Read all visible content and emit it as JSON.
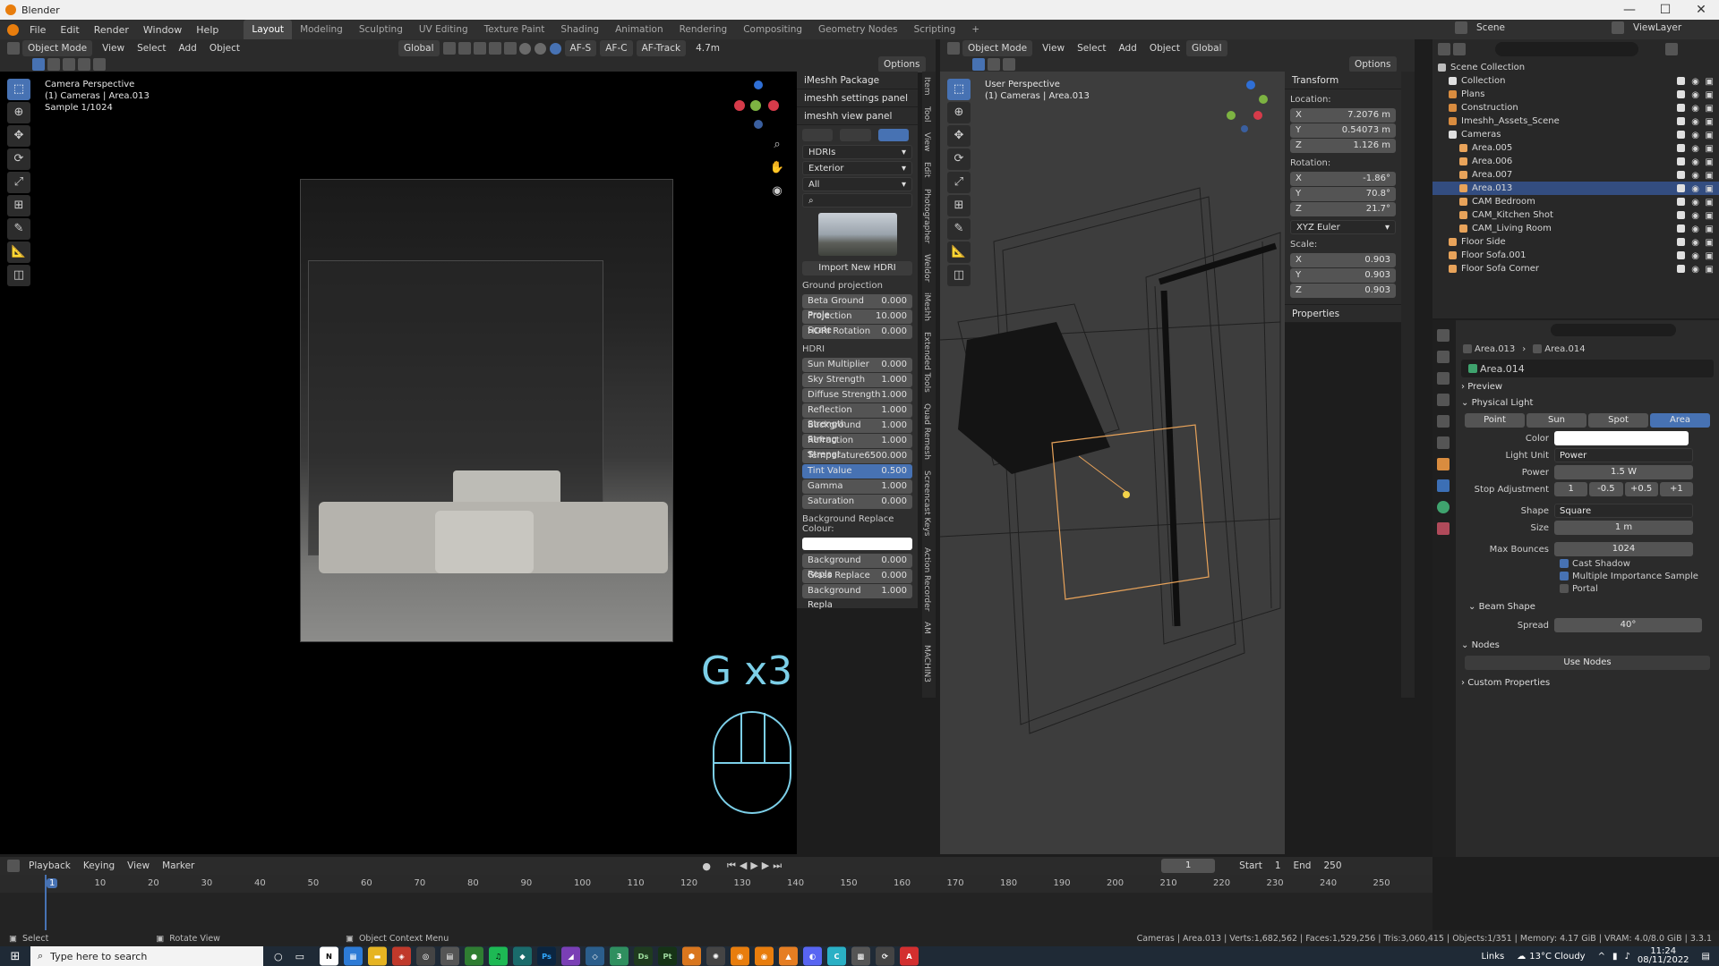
{
  "app": {
    "title": "Blender"
  },
  "window_controls": {
    "minimize": "—",
    "maximize": "☐",
    "close": "✕"
  },
  "menu": [
    "File",
    "Edit",
    "Render",
    "Window",
    "Help"
  ],
  "workspaces": [
    "Layout",
    "Modeling",
    "Sculpting",
    "UV Editing",
    "Texture Paint",
    "Shading",
    "Animation",
    "Rendering",
    "Compositing",
    "Geometry Nodes",
    "Scripting",
    "+"
  ],
  "scene": {
    "name": "Scene",
    "viewlayer": "ViewLayer"
  },
  "left_viewport": {
    "mode": "Object Mode",
    "menus": [
      "View",
      "Select",
      "Add",
      "Object"
    ],
    "orientation": "Global",
    "af_s": "AF-S",
    "af_c": "AF-C",
    "af_track": "AF-Track",
    "focal": "4.7m",
    "options": "Options",
    "info": [
      "Camera Perspective",
      "(1) Cameras | Area.013",
      "Sample 1/1024"
    ],
    "overlay_key": "G x3"
  },
  "imeshh": {
    "panel1": "iMeshh Package",
    "panel2": "imeshh settings panel",
    "panel3": "imeshh view panel",
    "drop1": "HDRIs",
    "drop2": "Exterior",
    "drop3": "All",
    "import_btn": "Import New HDRI",
    "ground_label": "Ground projection",
    "ground_fields": [
      {
        "label": "Beta Ground Proje",
        "value": "0.000"
      },
      {
        "label": "Projection Scale",
        "value": "10.000"
      },
      {
        "label": "HDRI Rotation",
        "value": "0.000"
      }
    ],
    "hdri_label": "HDRI",
    "hdri_fields": [
      {
        "label": "Sun Multiplier",
        "value": "0.000"
      },
      {
        "label": "Sky Strength",
        "value": "1.000"
      },
      {
        "label": "Diffuse Strength",
        "value": "1.000"
      },
      {
        "label": "Reflection Strength",
        "value": "1.000"
      },
      {
        "label": "Background Streng",
        "value": "1.000"
      },
      {
        "label": "Refraction Strengt",
        "value": "1.000"
      },
      {
        "label": "Temperature",
        "value": "6500.000"
      },
      {
        "label": "Tint Value",
        "value": "0.500"
      },
      {
        "label": "Gamma",
        "value": "1.000"
      },
      {
        "label": "Saturation",
        "value": "0.000"
      }
    ],
    "bg_replace_label": "Background Replace Colour:",
    "bg_fields": [
      {
        "label": "Background Repla",
        "value": "0.000"
      },
      {
        "label": "Glass Replace",
        "value": "0.000"
      },
      {
        "label": "Background Repla",
        "value": "1.000"
      }
    ]
  },
  "vtabs_left": [
    "Item",
    "Tool",
    "View",
    "Edit",
    "Photographer",
    "Weldor",
    "iMeshh",
    "Extended Tools",
    "Quad Remesh",
    "Screencast Keys",
    "Action Recorder",
    "AM",
    "MACHIN3"
  ],
  "right_viewport": {
    "mode": "Object Mode",
    "menus": [
      "View",
      "Select",
      "Add",
      "Object"
    ],
    "orientation": "Global",
    "options": "Options",
    "info": [
      "User Perspective",
      "(1) Cameras | Area.013"
    ]
  },
  "transform": {
    "title": "Transform",
    "location_label": "Location:",
    "location": [
      {
        "axis": "X",
        "value": "7.2076 m"
      },
      {
        "axis": "Y",
        "value": "0.54073 m"
      },
      {
        "axis": "Z",
        "value": "1.126 m"
      }
    ],
    "rotation_label": "Rotation:",
    "rotation": [
      {
        "axis": "X",
        "value": "-1.86°"
      },
      {
        "axis": "Y",
        "value": "70.8°"
      },
      {
        "axis": "Z",
        "value": "21.7°"
      }
    ],
    "euler": "XYZ Euler",
    "scale_label": "Scale:",
    "scale": [
      {
        "axis": "X",
        "value": "0.903"
      },
      {
        "axis": "Y",
        "value": "0.903"
      },
      {
        "axis": "Z",
        "value": "0.903"
      }
    ],
    "properties": "Properties"
  },
  "outliner": {
    "rows": [
      {
        "name": "Scene Collection",
        "indent": 0,
        "color": "#bdbdbd"
      },
      {
        "name": "Collection",
        "indent": 1,
        "color": "#e0e0e0"
      },
      {
        "name": "Plans",
        "indent": 1,
        "color": "#d98c3f"
      },
      {
        "name": "Construction",
        "indent": 1,
        "color": "#d98c3f"
      },
      {
        "name": "Imeshh_Assets_Scene",
        "indent": 1,
        "color": "#d98c3f"
      },
      {
        "name": "Cameras",
        "indent": 1,
        "color": "#e0e0e0"
      },
      {
        "name": "Area.005",
        "indent": 2,
        "color": "#e8a35a"
      },
      {
        "name": "Area.006",
        "indent": 2,
        "color": "#e8a35a"
      },
      {
        "name": "Area.007",
        "indent": 2,
        "color": "#e8a35a"
      },
      {
        "name": "Area.013",
        "indent": 2,
        "color": "#e8a35a",
        "selected": true
      },
      {
        "name": "CAM Bedroom",
        "indent": 2,
        "color": "#e8a35a"
      },
      {
        "name": "CAM_Kitchen Shot",
        "indent": 2,
        "color": "#e8a35a"
      },
      {
        "name": "CAM_Living Room",
        "indent": 2,
        "color": "#e8a35a"
      },
      {
        "name": "Floor Side",
        "indent": 1,
        "color": "#e8a35a"
      },
      {
        "name": "Floor Sofa.001",
        "indent": 1,
        "color": "#e8a35a"
      },
      {
        "name": "Floor Sofa Corner",
        "indent": 1,
        "color": "#e8a35a"
      }
    ]
  },
  "properties": {
    "breadcrumb1": "Area.013",
    "breadcrumb2": "Area.014",
    "datablock": "Area.014",
    "preview": "Preview",
    "physical_light": "Physical Light",
    "light_types": [
      "Point",
      "Sun",
      "Spot",
      "Area"
    ],
    "color_label": "Color",
    "light_unit_label": "Light Unit",
    "light_unit": "Power",
    "power_label": "Power",
    "power": "1.5 W",
    "stop_label": "Stop Adjustment",
    "stops": [
      "1",
      "-0.5",
      "+0.5",
      "+1"
    ],
    "shape_label": "Shape",
    "shape": "Square",
    "size_label": "Size",
    "size": "1 m",
    "bounces_label": "Max Bounces",
    "bounces": "1024",
    "cast_shadow": "Cast Shadow",
    "mis": "Multiple Importance Sample",
    "portal": "Portal",
    "beam_shape": "Beam Shape",
    "spread_label": "Spread",
    "spread": "40°",
    "nodes": "Nodes",
    "use_nodes": "Use Nodes",
    "custom": "Custom Properties"
  },
  "timeline": {
    "menus": [
      "Playback",
      "Keying",
      "View",
      "Marker"
    ],
    "current": "1",
    "start_label": "Start",
    "start": "1",
    "end_label": "End",
    "end": "250",
    "ticks": [
      "1",
      "10",
      "20",
      "30",
      "40",
      "50",
      "60",
      "70",
      "80",
      "90",
      "100",
      "110",
      "120",
      "130",
      "140",
      "150",
      "160",
      "170",
      "180",
      "190",
      "200",
      "210",
      "220",
      "230",
      "240",
      "250"
    ]
  },
  "statusbar": {
    "select": "Select",
    "rotate": "Rotate View",
    "context": "Object Context Menu",
    "stats": "Cameras | Area.013 | Verts:1,682,562 | Faces:1,529,256 | Tris:3,060,415 | Objects:1/351 | Memory: 4.17 GiB | VRAM: 4.0/8.0 GiB | 3.3.1"
  },
  "taskbar": {
    "search_placeholder": "Type here to search",
    "links": "Links",
    "weather": "13°C  Cloudy",
    "time": "11:24",
    "date": "08/11/2022",
    "apps": [
      {
        "name": "notion",
        "label": "N",
        "color": "#ffffff",
        "fg": "#000"
      },
      {
        "name": "calculator",
        "label": "▦",
        "color": "#2d7bd6",
        "fg": "#fff"
      },
      {
        "name": "explorer",
        "label": "▬",
        "color": "#e6b422",
        "fg": "#fff"
      },
      {
        "name": "app-red",
        "label": "◈",
        "color": "#c0392b",
        "fg": "#fff"
      },
      {
        "name": "app-circle",
        "label": "◎",
        "color": "#444",
        "fg": "#fff"
      },
      {
        "name": "calc2",
        "label": "▤",
        "color": "#555",
        "fg": "#fff"
      },
      {
        "name": "chrome",
        "label": "●",
        "color": "#2f7d32",
        "fg": "#fff"
      },
      {
        "name": "spotify",
        "label": "♫",
        "color": "#1db954",
        "fg": "#000"
      },
      {
        "name": "app-teal",
        "label": "◆",
        "color": "#1a6b6b",
        "fg": "#fff"
      },
      {
        "name": "photoshop",
        "label": "Ps",
        "color": "#0b2540",
        "fg": "#31a8ff"
      },
      {
        "name": "app-purple",
        "label": "◢",
        "color": "#7a3fb5",
        "fg": "#fff"
      },
      {
        "name": "app-cube",
        "label": "◇",
        "color": "#2b5e8c",
        "fg": "#fff"
      },
      {
        "name": "sketchup",
        "label": "3",
        "color": "#2f8f5f",
        "fg": "#fff"
      },
      {
        "name": "davinci",
        "label": "Ds",
        "color": "#1f3b1f",
        "fg": "#9fe09f"
      },
      {
        "name": "painter",
        "label": "Pt",
        "color": "#163316",
        "fg": "#9fd89f"
      },
      {
        "name": "app-orange",
        "label": "⬢",
        "color": "#d9761e",
        "fg": "#fff"
      },
      {
        "name": "app-gear",
        "label": "✺",
        "color": "#444",
        "fg": "#fff"
      },
      {
        "name": "blender-1",
        "label": "◉",
        "color": "#e87d0d",
        "fg": "#fff"
      },
      {
        "name": "blender-2",
        "label": "◉",
        "color": "#e87d0d",
        "fg": "#fff"
      },
      {
        "name": "vlc",
        "label": "▲",
        "color": "#e67e22",
        "fg": "#fff"
      },
      {
        "name": "discord",
        "label": "◐",
        "color": "#5865f2",
        "fg": "#fff"
      },
      {
        "name": "app-c",
        "label": "C",
        "color": "#2ab0c5",
        "fg": "#fff"
      },
      {
        "name": "app-square",
        "label": "▩",
        "color": "#555",
        "fg": "#fff"
      },
      {
        "name": "app-sync",
        "label": "⟳",
        "color": "#444",
        "fg": "#fff"
      },
      {
        "name": "acrobat",
        "label": "A",
        "color": "#d32f2f",
        "fg": "#fff"
      }
    ]
  },
  "colors": {
    "accent": "#4772b3",
    "selection": "#334d80",
    "orange": "#e87d0d",
    "overlay_text": "#7ccfe8"
  }
}
